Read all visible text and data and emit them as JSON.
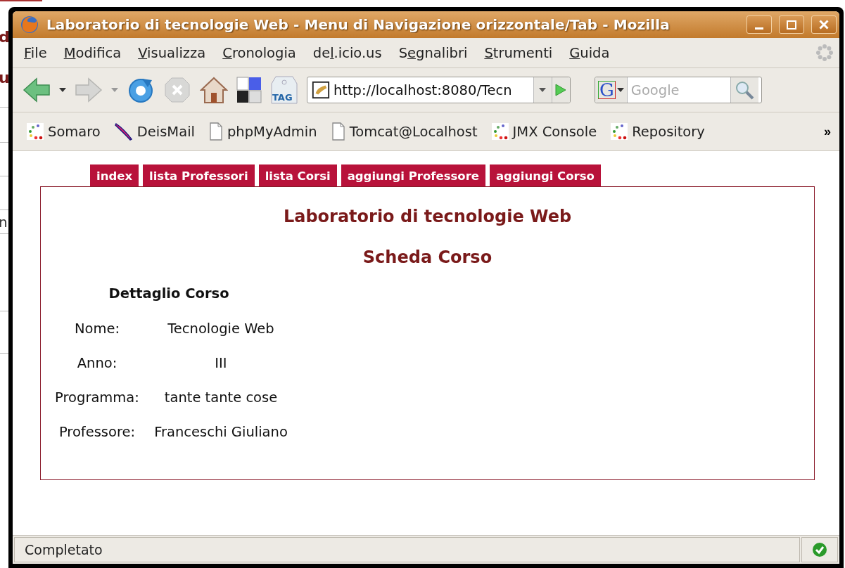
{
  "background_window": {
    "fragments": [
      "d",
      "u",
      "n"
    ]
  },
  "window": {
    "title": "Laboratorio di tecnologie Web - Menu di Navigazione orizzontale/Tab - Mozilla"
  },
  "menu": [
    {
      "key": "F",
      "after": "ile"
    },
    {
      "key": "M",
      "after": "odifica"
    },
    {
      "key": "V",
      "after": "isualizza"
    },
    {
      "key": "C",
      "after": "ronologia"
    },
    {
      "before": "de",
      "key": "l",
      "after": ".icio.us"
    },
    {
      "before": "S",
      "key": "e",
      "after": "gnalibri"
    },
    {
      "key": "S",
      "after": "trumenti"
    },
    {
      "key": "G",
      "after": "uida"
    }
  ],
  "toolbar": {
    "tag_label": "TAG",
    "url": "http://localhost:8080/Tecn",
    "search_engine_letter": "G",
    "search_placeholder": "Google"
  },
  "bookmarks": [
    {
      "label": "Somaro",
      "kind": "dots"
    },
    {
      "label": "DeisMail",
      "kind": "feather"
    },
    {
      "label": "phpMyAdmin",
      "kind": "page"
    },
    {
      "label": "Tomcat@Localhost",
      "kind": "page"
    },
    {
      "label": "JMX Console",
      "kind": "dots"
    },
    {
      "label": "Repository",
      "kind": "dots"
    }
  ],
  "bookmarks_more": "»",
  "tabs": [
    {
      "label": "index",
      "selected": false
    },
    {
      "label": "lista Professori",
      "selected": false
    },
    {
      "label": "lista Corsi",
      "selected": false
    },
    {
      "label": "aggiungi Professore",
      "selected": false
    },
    {
      "label": "aggiungi Corso",
      "selected": false
    }
  ],
  "page": {
    "heading": "Laboratorio di tecnologie Web",
    "subheading": "Scheda Corso",
    "detail_title": "Dettaglio Corso",
    "fields": [
      {
        "label": "Nome:",
        "value": "Tecnologie Web"
      },
      {
        "label": "Anno:",
        "value": "III"
      },
      {
        "label": "Programma:",
        "value": "tante tante cose"
      },
      {
        "label": "Professore:",
        "value": "Franceschi Giuliano"
      }
    ]
  },
  "status_bar": {
    "text": "Completato"
  }
}
